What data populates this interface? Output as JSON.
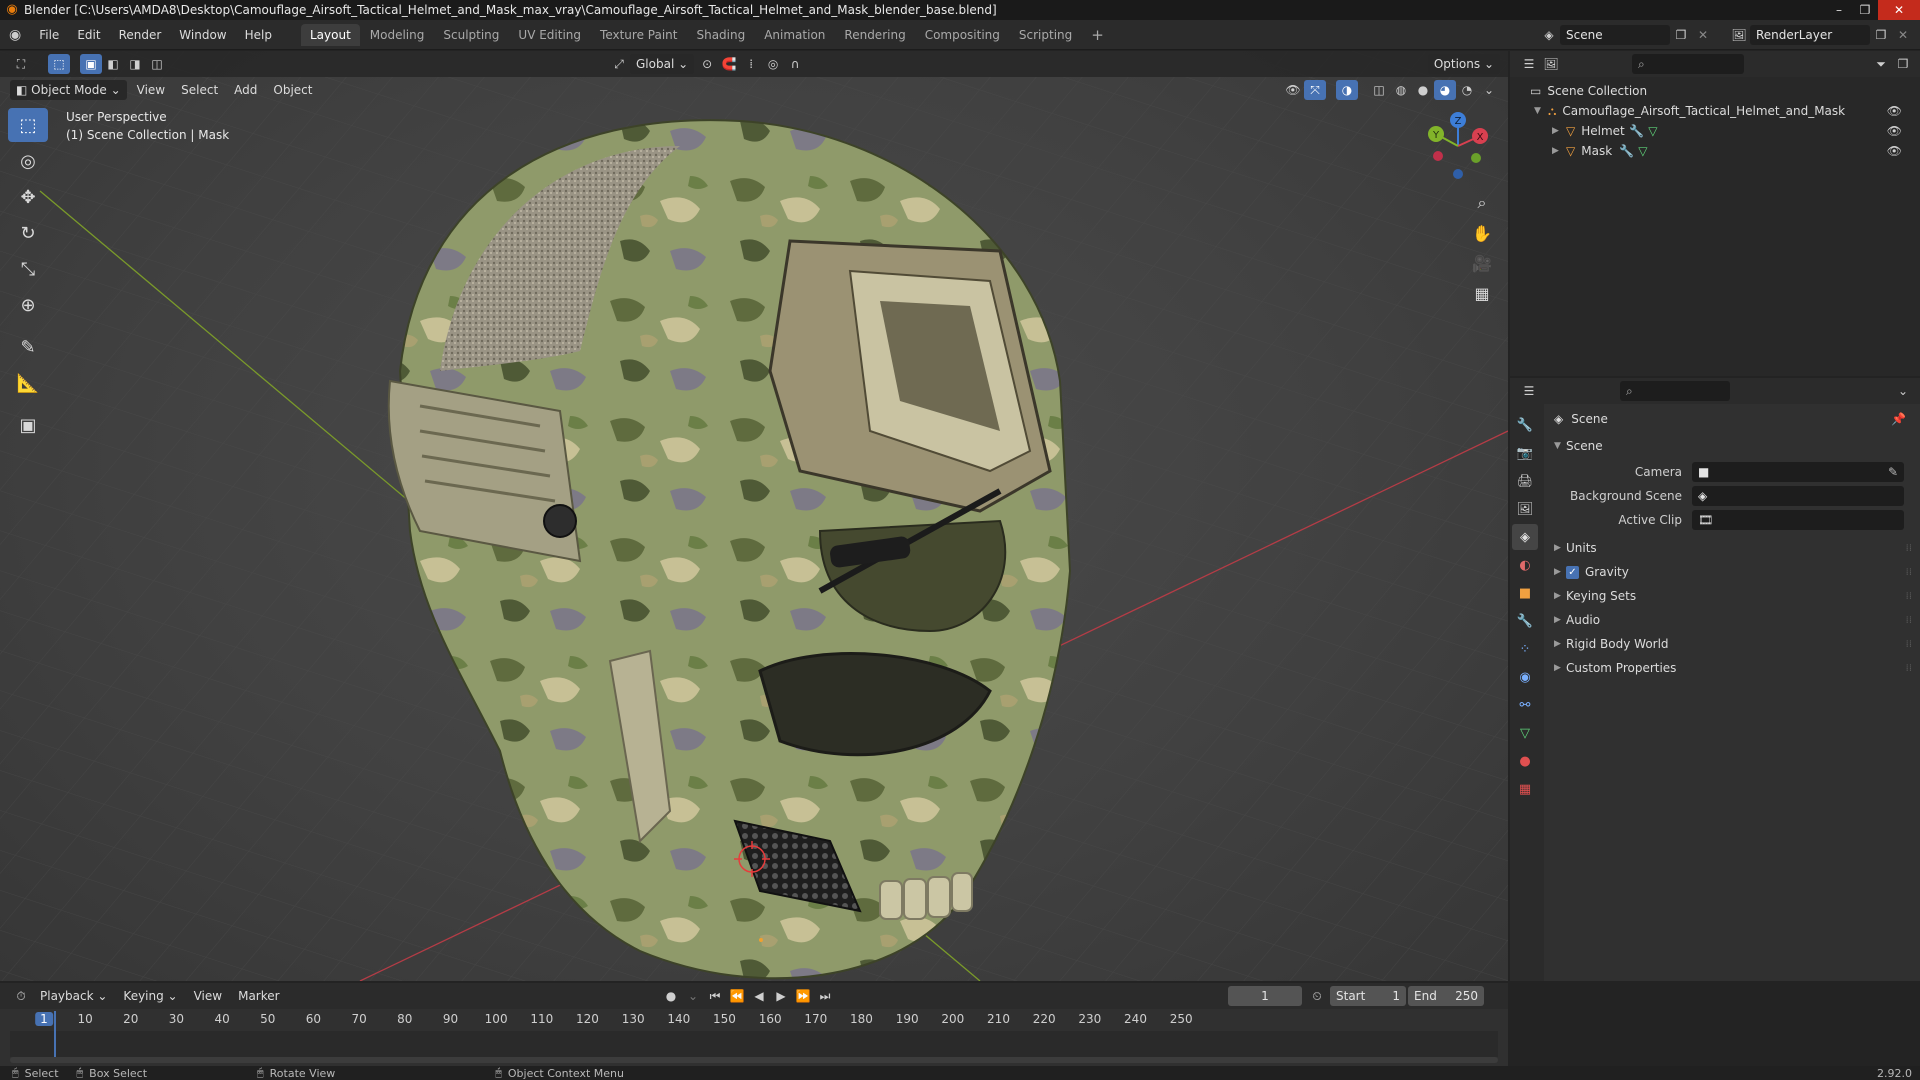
{
  "window": {
    "title": "Blender [C:\\Users\\AMDA8\\Desktop\\Camouflage_Airsoft_Tactical_Helmet_and_Mask_max_vray\\Camouflage_Airsoft_Tactical_Helmet_and_Mask_blender_base.blend]",
    "minimize": "–",
    "maximize": "❐",
    "close": "✕"
  },
  "menu": [
    "File",
    "Edit",
    "Render",
    "Window",
    "Help"
  ],
  "workspaces": [
    "Layout",
    "Modeling",
    "Sculpting",
    "UV Editing",
    "Texture Paint",
    "Shading",
    "Animation",
    "Rendering",
    "Compositing",
    "Scripting"
  ],
  "active_workspace": "Layout",
  "add_workspace": "+",
  "scene_selector": {
    "label": "Scene",
    "icon": "scene-icon"
  },
  "renderlayer_selector": {
    "label": "RenderLayer",
    "icon": "renderlayer-icon"
  },
  "viewport": {
    "transform_orientation": "Global",
    "options": "Options",
    "mode": "Object Mode",
    "menu": [
      "View",
      "Select",
      "Add",
      "Object"
    ],
    "overlay_text_line1": "User Perspective",
    "overlay_text_line2": "(1) Scene Collection | Mask",
    "gizmo_axes": {
      "x": "X",
      "y": "Y",
      "z": "Z"
    }
  },
  "tools": [
    {
      "name": "select-box-icon",
      "glyph": "⬚",
      "active": true
    },
    {
      "name": "cursor-icon",
      "glyph": "◎",
      "active": false
    },
    {
      "name": "move-icon",
      "glyph": "✥",
      "active": false
    },
    {
      "name": "rotate-icon",
      "glyph": "↻",
      "active": false
    },
    {
      "name": "scale-icon",
      "glyph": "⤡",
      "active": false
    },
    {
      "name": "transform-icon",
      "glyph": "⊕",
      "active": false
    },
    {
      "name": "annotate-icon",
      "glyph": "✎",
      "active": false
    },
    {
      "name": "measure-icon",
      "glyph": "📐",
      "active": false
    },
    {
      "name": "add-cube-icon",
      "glyph": "▣",
      "active": false
    }
  ],
  "outliner": {
    "root": "Scene Collection",
    "collection": "Camouflage_Airsoft_Tactical_Helmet_and_Mask",
    "objects": [
      "Helmet",
      "Mask"
    ]
  },
  "properties": {
    "header": "Scene",
    "section": "Scene",
    "fields": [
      {
        "label": "Camera",
        "value": ""
      },
      {
        "label": "Background Scene",
        "value": ""
      },
      {
        "label": "Active Clip",
        "value": ""
      }
    ],
    "panels": [
      {
        "label": "Units",
        "checkbox": false
      },
      {
        "label": "Gravity",
        "checkbox": true
      },
      {
        "label": "Keying Sets",
        "checkbox": false
      },
      {
        "label": "Audio",
        "checkbox": false
      },
      {
        "label": "Rigid Body World",
        "checkbox": false
      },
      {
        "label": "Custom Properties",
        "checkbox": false
      }
    ],
    "tabs": [
      {
        "name": "tool-tab-icon",
        "glyph": "🔧",
        "color": "#cfcfcf"
      },
      {
        "name": "render-tab-icon",
        "glyph": "📷",
        "color": "#cfcfcf"
      },
      {
        "name": "output-tab-icon",
        "glyph": "🖨",
        "color": "#cfcfcf"
      },
      {
        "name": "view-layer-tab-icon",
        "glyph": "🖼",
        "color": "#cfcfcf"
      },
      {
        "name": "scene-tab-icon",
        "glyph": "◈",
        "color": "#e0e0e0"
      },
      {
        "name": "world-tab-icon",
        "glyph": "◐",
        "color": "#e06a6a"
      },
      {
        "name": "object-tab-icon",
        "glyph": "■",
        "color": "#f0a040"
      },
      {
        "name": "modifier-tab-icon",
        "glyph": "🔧",
        "color": "#6aa0e0"
      },
      {
        "name": "particles-tab-icon",
        "glyph": "⁘",
        "color": "#7ab0ff"
      },
      {
        "name": "physics-tab-icon",
        "glyph": "◉",
        "color": "#7ab0ff"
      },
      {
        "name": "constraints-tab-icon",
        "glyph": "⚯",
        "color": "#7ab0ff"
      },
      {
        "name": "data-tab-icon",
        "glyph": "▽",
        "color": "#5fd37a"
      },
      {
        "name": "material-tab-icon",
        "glyph": "●",
        "color": "#e05050"
      },
      {
        "name": "texture-tab-icon",
        "glyph": "▦",
        "color": "#e05050"
      }
    ]
  },
  "timeline": {
    "menu": [
      "Playback",
      "Keying",
      "View",
      "Marker"
    ],
    "current_frame": "1",
    "start_label": "Start",
    "start": "1",
    "end_label": "End",
    "end": "250",
    "ruler": [
      "1",
      "10",
      "20",
      "30",
      "40",
      "50",
      "60",
      "70",
      "80",
      "90",
      "100",
      "110",
      "120",
      "130",
      "140",
      "150",
      "160",
      "170",
      "180",
      "190",
      "200",
      "210",
      "220",
      "230",
      "240",
      "250"
    ]
  },
  "status": {
    "select": "Select",
    "box_select": "Box Select",
    "rotate_view": "Rotate View",
    "context_menu": "Object Context Menu",
    "version": "2.92.0"
  }
}
